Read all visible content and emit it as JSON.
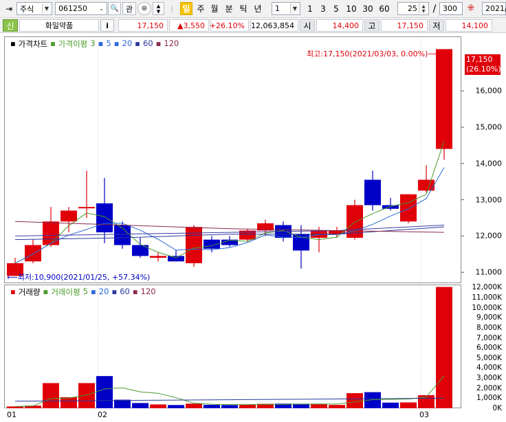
{
  "toolbar": {
    "market": "주식",
    "code": "061250",
    "btn_search": "🔍",
    "btn_interest": "관",
    "periods": [
      "일",
      "주",
      "월",
      "분",
      "틱",
      "년"
    ],
    "period_selected": "일",
    "interval_value": "1",
    "quick_intervals": [
      "1",
      "3",
      "5",
      "10",
      "30",
      "60"
    ],
    "count_value": "25",
    "total_count": "300",
    "date_value": "2021/"
  },
  "quote": {
    "badge": "신",
    "name": "화일약품",
    "info_btn": "i",
    "price": "17,150",
    "change": "▲3,550",
    "change_pct": "+26.10%",
    "volume": "12,063,854",
    "open_label": "시",
    "open": "14,400",
    "high_label": "고",
    "high": "17,150",
    "low_label": "저",
    "low": "14,100"
  },
  "price_legend": {
    "title": "가격차트",
    "ma_label": "가격이평",
    "ma_periods": [
      "3",
      "5",
      "20",
      "60",
      "120"
    ]
  },
  "volume_legend": {
    "title": "거래량",
    "ma_label": "거래이평",
    "ma_periods": [
      "5",
      "20",
      "60",
      "120"
    ]
  },
  "annotations": {
    "high": "최고:17,150(2021/03/03, 0.00%)",
    "low": "최저:10,900(2021/01/25, +57.34%)",
    "last_price": "17,150",
    "last_pct": "(26.10%)"
  },
  "colors": {
    "up": "#e0000a",
    "down": "#0000c8",
    "ma3": "#4a9a2a",
    "ma5": "#2a6ad8",
    "ma20": "#2a3a9a",
    "ma60": "#3a3aa0",
    "ma120": "#8a2a4a"
  },
  "axis": {
    "price_ticks": [
      "16,000",
      "15,000",
      "14,000",
      "13,000",
      "12,000",
      "11,000"
    ],
    "volume_ticks": [
      "12,000K",
      "11,000K",
      "10,000K",
      "9,000K",
      "8,000K",
      "7,000K",
      "6,000K",
      "5,000K",
      "4,000K",
      "3,000K",
      "2,000K",
      "1,000K",
      "0K"
    ],
    "x_labels": [
      "01",
      "02",
      "03"
    ]
  },
  "chart_data": {
    "type": "candlestick",
    "candles": [
      {
        "o": 10900,
        "h": 11400,
        "l": 10900,
        "c": 11250
      },
      {
        "o": 11300,
        "h": 11900,
        "l": 11250,
        "c": 11750
      },
      {
        "o": 11750,
        "h": 12800,
        "l": 11700,
        "c": 12400
      },
      {
        "o": 12400,
        "h": 12800,
        "l": 12100,
        "c": 12700
      },
      {
        "o": 12800,
        "h": 13800,
        "l": 12500,
        "c": 12800
      },
      {
        "o": 12900,
        "h": 13600,
        "l": 11800,
        "c": 12100
      },
      {
        "o": 12300,
        "h": 12400,
        "l": 11650,
        "c": 11750
      },
      {
        "o": 11750,
        "h": 11950,
        "l": 11400,
        "c": 11450
      },
      {
        "o": 11400,
        "h": 11550,
        "l": 11300,
        "c": 11450
      },
      {
        "o": 11450,
        "h": 11600,
        "l": 11300,
        "c": 11300
      },
      {
        "o": 11250,
        "h": 12300,
        "l": 11150,
        "c": 12250
      },
      {
        "o": 11900,
        "h": 12000,
        "l": 11550,
        "c": 11650
      },
      {
        "o": 11900,
        "h": 12000,
        "l": 11700,
        "c": 11750
      },
      {
        "o": 11900,
        "h": 12200,
        "l": 11850,
        "c": 12150
      },
      {
        "o": 12150,
        "h": 12450,
        "l": 12000,
        "c": 12350
      },
      {
        "o": 12300,
        "h": 12400,
        "l": 11850,
        "c": 11950
      },
      {
        "o": 12050,
        "h": 12300,
        "l": 11100,
        "c": 11600
      },
      {
        "o": 11950,
        "h": 12250,
        "l": 11550,
        "c": 12150
      },
      {
        "o": 12050,
        "h": 12250,
        "l": 11950,
        "c": 12150
      },
      {
        "o": 11950,
        "h": 13000,
        "l": 11900,
        "c": 12850
      },
      {
        "o": 13550,
        "h": 13800,
        "l": 12700,
        "c": 12850
      },
      {
        "o": 12850,
        "h": 13050,
        "l": 12700,
        "c": 12750
      },
      {
        "o": 12400,
        "h": 13150,
        "l": 12350,
        "c": 13150
      },
      {
        "o": 13250,
        "h": 13950,
        "l": 13200,
        "c": 13550
      },
      {
        "o": 14400,
        "h": 17150,
        "l": 14100,
        "c": 17150
      }
    ],
    "volume_k": [
      180,
      260,
      2500,
      1100,
      2500,
      3200,
      850,
      520,
      380,
      320,
      460,
      340,
      320,
      370,
      440,
      460,
      450,
      400,
      330,
      1500,
      1600,
      560,
      580,
      1300,
      12060
    ],
    "ylim": [
      10700,
      17500
    ],
    "volume_ylim": [
      0,
      12300
    ]
  }
}
